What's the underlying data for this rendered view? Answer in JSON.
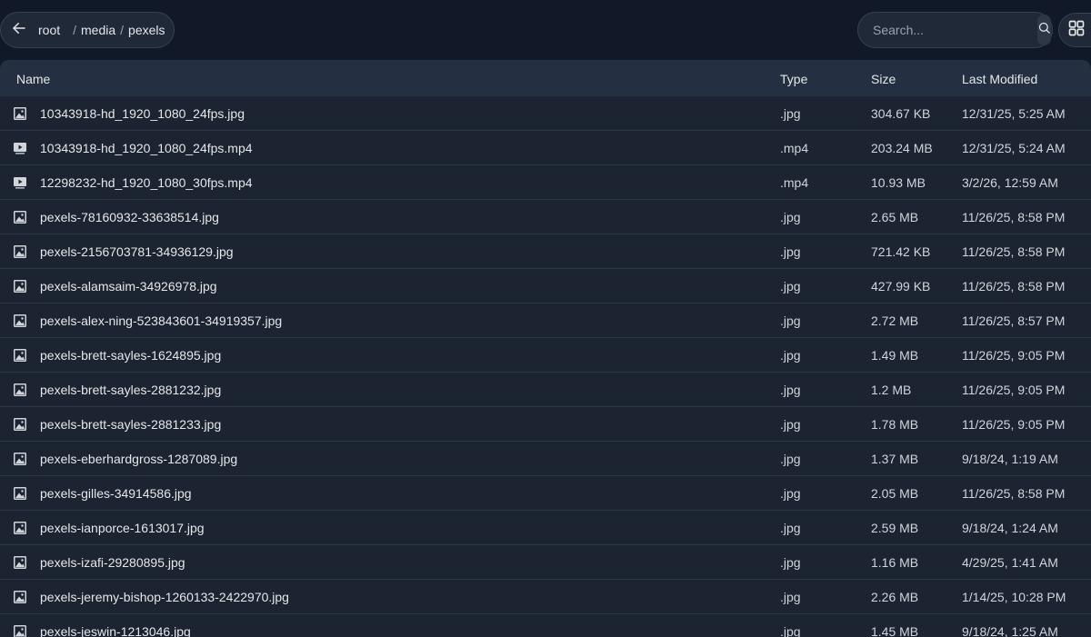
{
  "breadcrumb": {
    "root": "root",
    "segments": [
      "media",
      "pexels"
    ],
    "separator": "/"
  },
  "search": {
    "placeholder": "Search..."
  },
  "icons": {
    "back": "arrow-left-icon",
    "search": "search-icon",
    "view": "grid-view-icon",
    "image": "image-file-icon",
    "video": "video-file-icon"
  },
  "table": {
    "columns": {
      "name": "Name",
      "type": "Type",
      "size": "Size",
      "modified": "Last Modified"
    },
    "rows": [
      {
        "kind": "image",
        "name": "10343918-hd_1920_1080_24fps.jpg",
        "type": ".jpg",
        "size": "304.67 KB",
        "modified": "12/31/25, 5:25 AM"
      },
      {
        "kind": "video",
        "name": "10343918-hd_1920_1080_24fps.mp4",
        "type": ".mp4",
        "size": "203.24 MB",
        "modified": "12/31/25, 5:24 AM"
      },
      {
        "kind": "video",
        "name": "12298232-hd_1920_1080_30fps.mp4",
        "type": ".mp4",
        "size": "10.93 MB",
        "modified": "3/2/26, 12:59 AM"
      },
      {
        "kind": "image",
        "name": "pexels-78160932-33638514.jpg",
        "type": ".jpg",
        "size": "2.65 MB",
        "modified": "11/26/25, 8:58 PM"
      },
      {
        "kind": "image",
        "name": "pexels-2156703781-34936129.jpg",
        "type": ".jpg",
        "size": "721.42 KB",
        "modified": "11/26/25, 8:58 PM"
      },
      {
        "kind": "image",
        "name": "pexels-alamsaim-34926978.jpg",
        "type": ".jpg",
        "size": "427.99 KB",
        "modified": "11/26/25, 8:58 PM"
      },
      {
        "kind": "image",
        "name": "pexels-alex-ning-523843601-34919357.jpg",
        "type": ".jpg",
        "size": "2.72 MB",
        "modified": "11/26/25, 8:57 PM"
      },
      {
        "kind": "image",
        "name": "pexels-brett-sayles-1624895.jpg",
        "type": ".jpg",
        "size": "1.49 MB",
        "modified": "11/26/25, 9:05 PM"
      },
      {
        "kind": "image",
        "name": "pexels-brett-sayles-2881232.jpg",
        "type": ".jpg",
        "size": "1.2 MB",
        "modified": "11/26/25, 9:05 PM"
      },
      {
        "kind": "image",
        "name": "pexels-brett-sayles-2881233.jpg",
        "type": ".jpg",
        "size": "1.78 MB",
        "modified": "11/26/25, 9:05 PM"
      },
      {
        "kind": "image",
        "name": "pexels-eberhardgross-1287089.jpg",
        "type": ".jpg",
        "size": "1.37 MB",
        "modified": "9/18/24, 1:19 AM"
      },
      {
        "kind": "image",
        "name": "pexels-gilles-34914586.jpg",
        "type": ".jpg",
        "size": "2.05 MB",
        "modified": "11/26/25, 8:58 PM"
      },
      {
        "kind": "image",
        "name": "pexels-ianporce-1613017.jpg",
        "type": ".jpg",
        "size": "2.59 MB",
        "modified": "9/18/24, 1:24 AM"
      },
      {
        "kind": "image",
        "name": "pexels-izafi-29280895.jpg",
        "type": ".jpg",
        "size": "1.16 MB",
        "modified": "4/29/25, 1:41 AM"
      },
      {
        "kind": "image",
        "name": "pexels-jeremy-bishop-1260133-2422970.jpg",
        "type": ".jpg",
        "size": "2.26 MB",
        "modified": "1/14/25, 10:28 PM"
      },
      {
        "kind": "image",
        "name": "pexels-jeswin-1213046.jpg",
        "type": ".jpg",
        "size": "1.45 MB",
        "modified": "9/18/24, 1:25 AM"
      }
    ]
  }
}
